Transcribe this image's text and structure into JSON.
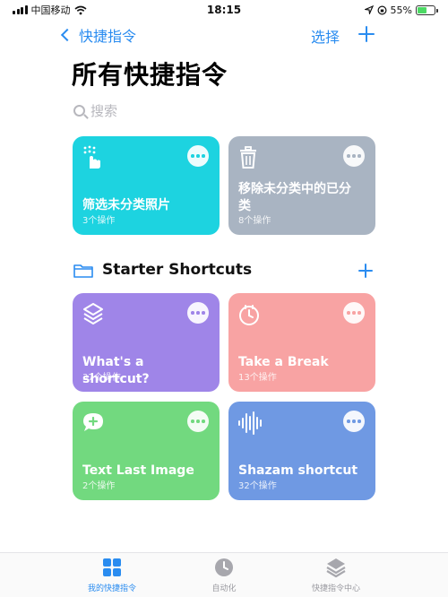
{
  "status": {
    "carrier": "中国移动",
    "time": "18:15",
    "battery": "55%",
    "battery_level": 0.55
  },
  "nav": {
    "back_label": "快捷指令",
    "select_label": "选择"
  },
  "page": {
    "title": "所有快捷指令",
    "search_placeholder": "搜索"
  },
  "cards": [
    {
      "title": "筛选未分类照片",
      "sub": "3个操作",
      "icon": "hand-tap-icon",
      "color": "#1dd3e0"
    },
    {
      "title": "移除未分类中的已分类",
      "sub": "8个操作",
      "icon": "trash-icon",
      "color": "#a9b4c2"
    }
  ],
  "section": {
    "title": "Starter Shortcuts",
    "icon": "folder-icon"
  },
  "starter_cards": [
    {
      "title": "What's a shortcut?",
      "sub": "37个操作",
      "icon": "layers-icon",
      "color": "#9f85e8"
    },
    {
      "title": "Take a Break",
      "sub": "13个操作",
      "icon": "timer-icon",
      "color": "#f8a3a3"
    },
    {
      "title": "Text Last Image",
      "sub": "2个操作",
      "icon": "message-plus-icon",
      "color": "#72d97f"
    },
    {
      "title": "Shazam shortcut",
      "sub": "32个操作",
      "icon": "waveform-icon",
      "color": "#6f99e3"
    }
  ],
  "tabs": [
    {
      "label": "我的快捷指令",
      "active": true,
      "icon": "grid-icon"
    },
    {
      "label": "自动化",
      "active": false,
      "icon": "clock-check-icon"
    },
    {
      "label": "快捷指令中心",
      "active": false,
      "icon": "layers-icon"
    }
  ]
}
